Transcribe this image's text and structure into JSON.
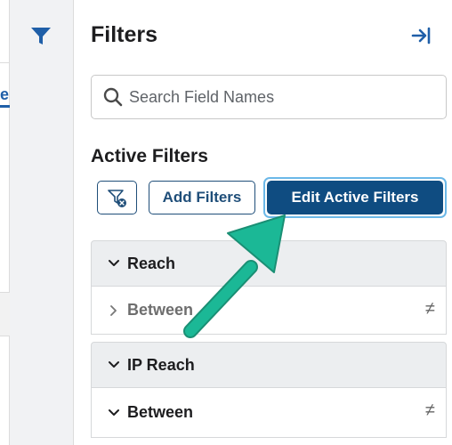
{
  "main": {
    "tab_fragment": "e"
  },
  "panel": {
    "title": "Filters",
    "collapse_icon": "collapse-right-icon",
    "search": {
      "placeholder": "Search Field Names",
      "value": "",
      "icon": "search-icon"
    },
    "active_filters_title": "Active Filters",
    "buttons": {
      "clear_icon": "clear-filter-icon",
      "add_label": "Add Filters",
      "edit_label": "Edit Active Filters"
    },
    "groups": [
      {
        "label": "Reach",
        "expanded": true,
        "conditions": [
          {
            "label": "Between",
            "expanded": false,
            "operator_symbol": "≠"
          }
        ]
      },
      {
        "label": "IP Reach",
        "expanded": true,
        "conditions": [
          {
            "label": "Between",
            "expanded": true,
            "operator_symbol": "≠"
          }
        ]
      }
    ]
  },
  "colors": {
    "brand_blue": "#0f4c81",
    "outline_blue": "#1f4e79",
    "focus_ring": "#6bb8e8",
    "annotation_arrow": "#1bb896",
    "rail_bg": "#f1f2f4",
    "group_bg": "#eceef0"
  }
}
